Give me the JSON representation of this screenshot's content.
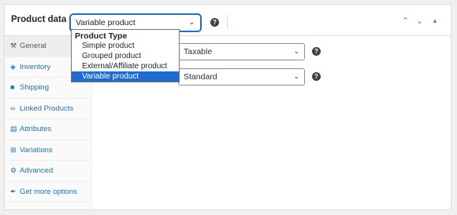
{
  "header": {
    "title": "Product data —",
    "product_type_value": "Variable product"
  },
  "product_type_menu": {
    "group_label": "Product Type",
    "options": [
      "Simple product",
      "Grouped product",
      "External/Affiliate product",
      "Variable product"
    ],
    "selected": "Variable product"
  },
  "sidebar": {
    "tabs": [
      {
        "label": "General",
        "icon": "wrench-icon",
        "active": true
      },
      {
        "label": "Inventory",
        "icon": "tag-icon",
        "active": false
      },
      {
        "label": "Shipping",
        "icon": "truck-icon",
        "active": false
      },
      {
        "label": "Linked Products",
        "icon": "link-icon",
        "active": false
      },
      {
        "label": "Attributes",
        "icon": "list-icon",
        "active": false
      },
      {
        "label": "Variations",
        "icon": "grid-icon",
        "active": false
      },
      {
        "label": "Advanced",
        "icon": "gear-icon",
        "active": false
      },
      {
        "label": "Get more options",
        "icon": "plugin-icon",
        "active": false
      }
    ]
  },
  "general": {
    "tax_status_value": "Taxable",
    "tax_class_value": "Standard"
  },
  "colors": {
    "accent": "#2271b1",
    "selected_option": "#1e6cd4"
  }
}
